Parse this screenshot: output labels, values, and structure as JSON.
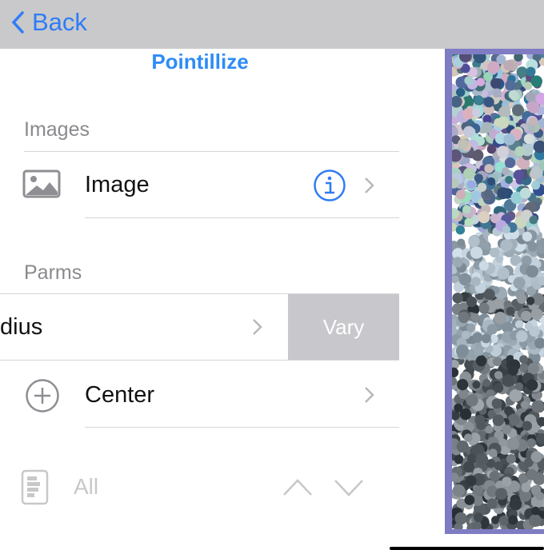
{
  "nav": {
    "back_label": "Back"
  },
  "title": "Pointillize",
  "sections": {
    "images": "Images",
    "parms": "Parms"
  },
  "rows": {
    "image": "Image",
    "radius": "dius",
    "vary": "Vary",
    "center": "Center"
  },
  "footer": {
    "all": "All"
  },
  "colors": {
    "accent": "#2f7cf6",
    "border": "#7f7cc4"
  }
}
